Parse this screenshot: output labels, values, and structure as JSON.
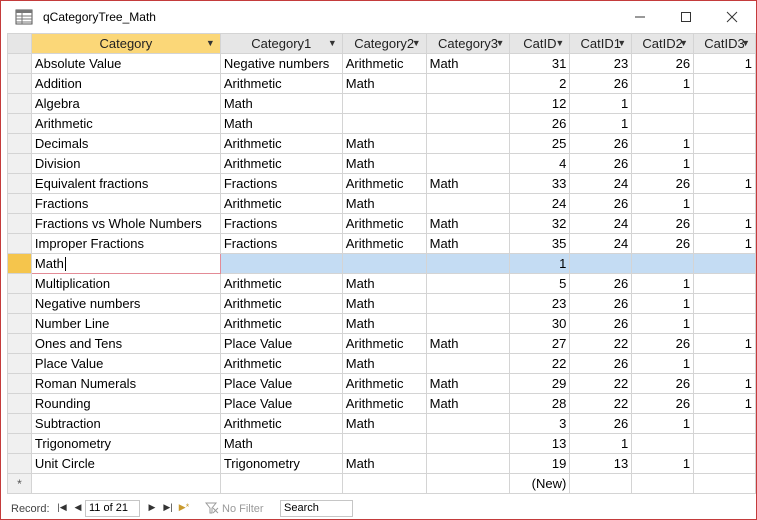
{
  "window": {
    "title": "qCategoryTree_Math",
    "icon": "datasheet-icon",
    "controls": [
      "minimize-icon",
      "maximize-icon",
      "close-icon"
    ]
  },
  "columns": [
    "Category",
    "Category1",
    "Category2",
    "Category3",
    "CatID",
    "CatID1",
    "CatID2",
    "CatID3"
  ],
  "rows": [
    [
      "Absolute Value",
      "Negative numbers",
      "Arithmetic",
      "Math",
      "31",
      "23",
      "26",
      "1"
    ],
    [
      "Addition",
      "Arithmetic",
      "Math",
      "",
      "2",
      "26",
      "1",
      ""
    ],
    [
      "Algebra",
      "Math",
      "",
      "",
      "12",
      "1",
      "",
      ""
    ],
    [
      "Arithmetic",
      "Math",
      "",
      "",
      "26",
      "1",
      "",
      ""
    ],
    [
      "Decimals",
      "Arithmetic",
      "Math",
      "",
      "25",
      "26",
      "1",
      ""
    ],
    [
      "Division",
      "Arithmetic",
      "Math",
      "",
      "4",
      "26",
      "1",
      ""
    ],
    [
      "Equivalent fractions",
      "Fractions",
      "Arithmetic",
      "Math",
      "33",
      "24",
      "26",
      "1"
    ],
    [
      "Fractions",
      "Arithmetic",
      "Math",
      "",
      "24",
      "26",
      "1",
      ""
    ],
    [
      "Fractions vs Whole Numbers",
      "Fractions",
      "Arithmetic",
      "Math",
      "32",
      "24",
      "26",
      "1"
    ],
    [
      "Improper Fractions",
      "Fractions",
      "Arithmetic",
      "Math",
      "35",
      "24",
      "26",
      "1"
    ],
    [
      "Math",
      "",
      "",
      "",
      "1",
      "",
      "",
      ""
    ],
    [
      "Multiplication",
      "Arithmetic",
      "Math",
      "",
      "5",
      "26",
      "1",
      ""
    ],
    [
      "Negative numbers",
      "Arithmetic",
      "Math",
      "",
      "23",
      "26",
      "1",
      ""
    ],
    [
      "Number Line",
      "Arithmetic",
      "Math",
      "",
      "30",
      "26",
      "1",
      ""
    ],
    [
      "Ones and Tens",
      "Place Value",
      "Arithmetic",
      "Math",
      "27",
      "22",
      "26",
      "1"
    ],
    [
      "Place Value",
      "Arithmetic",
      "Math",
      "",
      "22",
      "26",
      "1",
      ""
    ],
    [
      "Roman Numerals",
      "Place Value",
      "Arithmetic",
      "Math",
      "29",
      "22",
      "26",
      "1"
    ],
    [
      "Rounding",
      "Place Value",
      "Arithmetic",
      "Math",
      "28",
      "22",
      "26",
      "1"
    ],
    [
      "Subtraction",
      "Arithmetic",
      "Math",
      "",
      "3",
      "26",
      "1",
      ""
    ],
    [
      "Trigonometry",
      "Math",
      "",
      "",
      "13",
      "1",
      "",
      ""
    ],
    [
      "Unit Circle",
      "Trigonometry",
      "Math",
      "",
      "19",
      "13",
      "1",
      ""
    ]
  ],
  "current_row_index": 10,
  "new_row": {
    "marker": "*",
    "catid": "(New)"
  },
  "status": {
    "record_label": "Record:",
    "record_value": "11 of 21",
    "filter_label": "No Filter",
    "search_placeholder": "Search"
  },
  "colors": {
    "selected_header": "#fbd778",
    "current_row": "#c4dcf3",
    "window_border": "#c43b3b"
  }
}
